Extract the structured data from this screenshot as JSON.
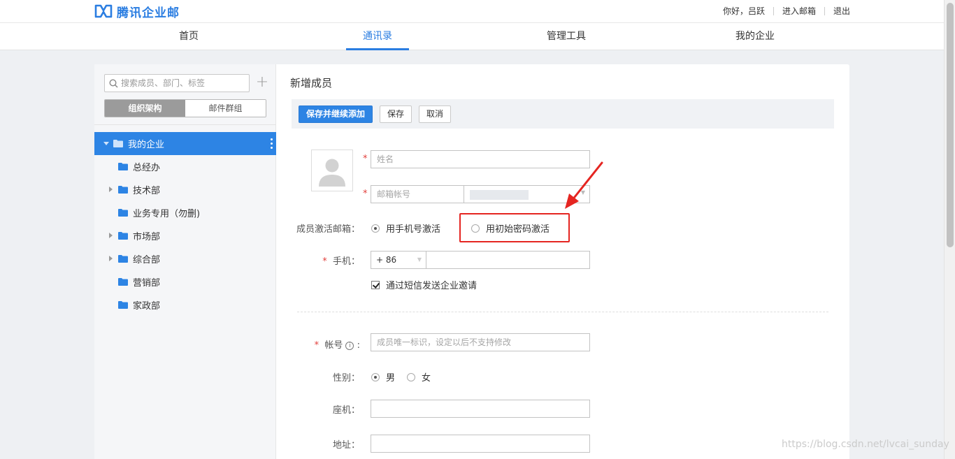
{
  "header": {
    "brand": "腾讯企业邮",
    "greeting": "你好，吕跃",
    "enter_mail": "进入邮箱",
    "logout": "退出"
  },
  "nav": {
    "items": [
      "首页",
      "通讯录",
      "管理工具",
      "我的企业"
    ],
    "active": "通讯录"
  },
  "sidebar": {
    "search_placeholder": "搜索成员、部门、标签",
    "tabs": [
      "组织架构",
      "邮件群组"
    ],
    "tree": [
      {
        "label": "我的企业",
        "level": 0,
        "selected": true
      },
      {
        "label": "总经办",
        "level": 1,
        "expandable": false
      },
      {
        "label": "技术部",
        "level": 1,
        "expandable": true
      },
      {
        "label": "业务专用（勿删)",
        "level": 1,
        "expandable": false
      },
      {
        "label": "市场部",
        "level": 1,
        "expandable": true
      },
      {
        "label": "综合部",
        "level": 1,
        "expandable": true
      },
      {
        "label": "营销部",
        "level": 1,
        "expandable": false
      },
      {
        "label": "家政部",
        "level": 1,
        "expandable": false
      }
    ]
  },
  "form": {
    "title": "新增成员",
    "buttons": {
      "save_continue": "保存并继续添加",
      "save": "保存",
      "cancel": "取消"
    },
    "name_placeholder": "姓名",
    "email_placeholder": "邮箱帐号",
    "activation_label": "成员激活邮箱：",
    "activation_options": [
      "用手机号激活",
      "用初始密码激活"
    ],
    "activation_selected": "用手机号激活",
    "phone_label": "手机：",
    "phone_code": "+ 86",
    "sms_invite_label": "通过短信发送企业邀请",
    "sms_invite_checked": true,
    "account_label": "帐号",
    "account_placeholder": "成员唯一标识，设定以后不支持修改",
    "gender_label": "性别：",
    "gender_options": [
      "男",
      "女"
    ],
    "gender_selected": "男",
    "landline_label": "座机：",
    "address_label": "地址："
  },
  "watermark": "https://blog.csdn.net/lvcai_sunday",
  "colors": {
    "accent": "#2d84e4",
    "brand": "#2a7de1",
    "required": "#e2403d",
    "annotation": "#e52521"
  }
}
